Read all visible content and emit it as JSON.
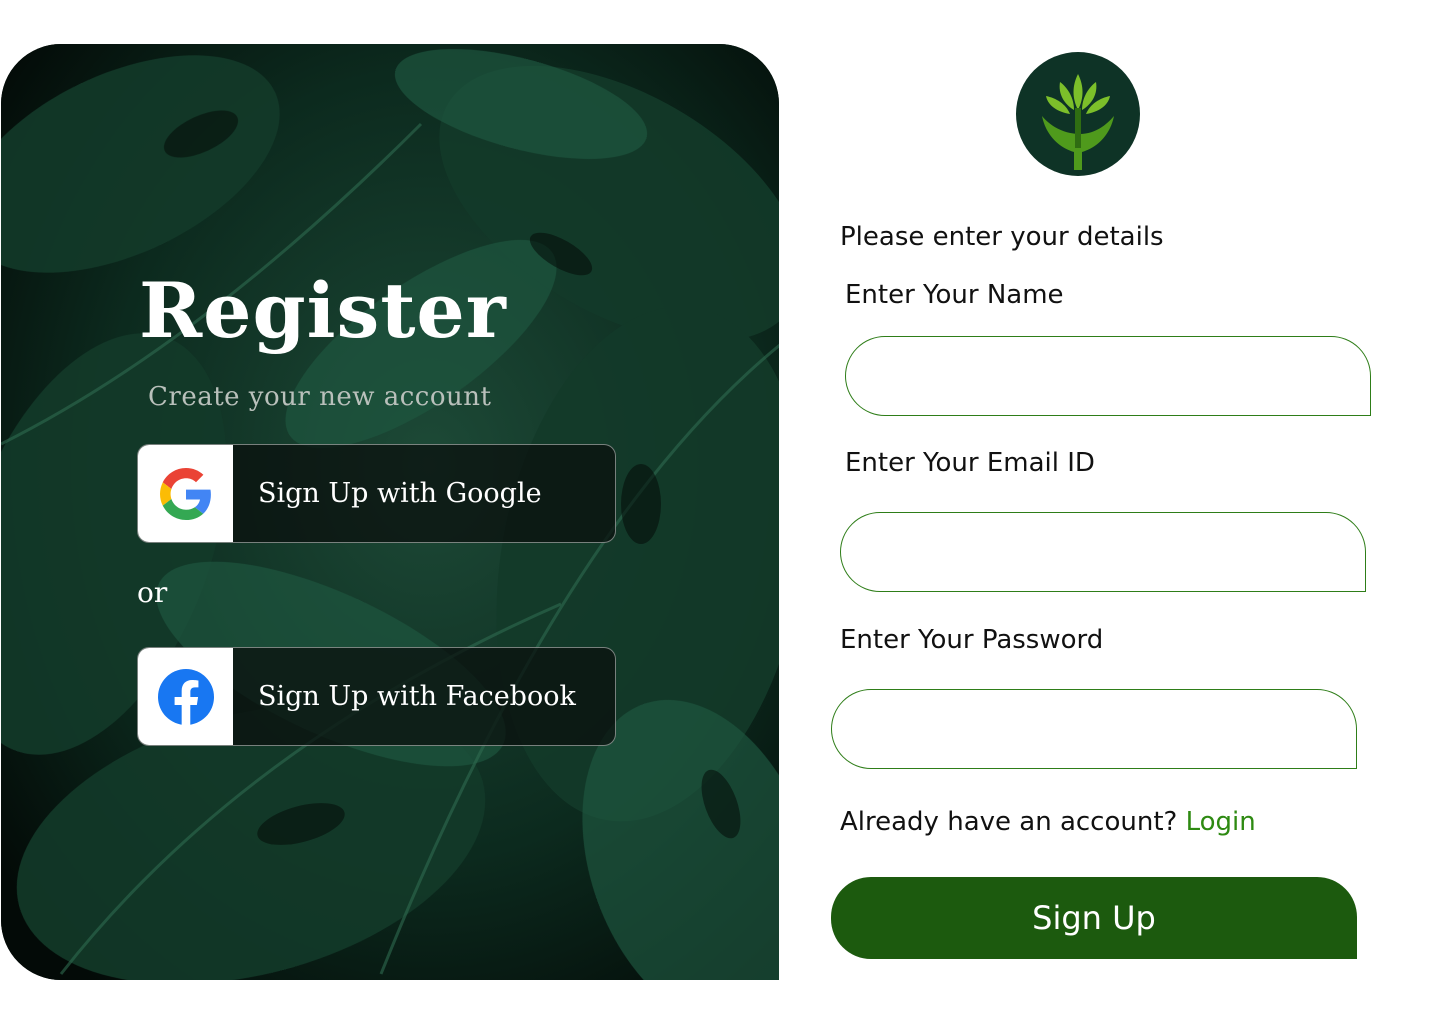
{
  "hero": {
    "title": "Register",
    "subtitle": "Create your new account",
    "google_label": "Sign Up with Google",
    "or_text": "or",
    "facebook_label": "Sign Up with Facebook",
    "icons": {
      "google": "google-logo-icon",
      "facebook": "facebook-logo-icon",
      "background": "tropical-leaves"
    }
  },
  "form": {
    "logo": "tree-hands-logo",
    "prompt": "Please enter your details",
    "name_label": "Enter Your Name",
    "name_value": "",
    "email_label": "Enter Your Email ID",
    "email_value": "",
    "password_label": "Enter Your Password",
    "password_value": "",
    "already_text": "Already have an account? ",
    "login_link": "Login",
    "submit_label": "Sign Up"
  },
  "colors": {
    "accent": "#1c5a0e",
    "link": "#2e8a12",
    "field_border": "#2e7d18",
    "hero_bg": "#04100b"
  }
}
